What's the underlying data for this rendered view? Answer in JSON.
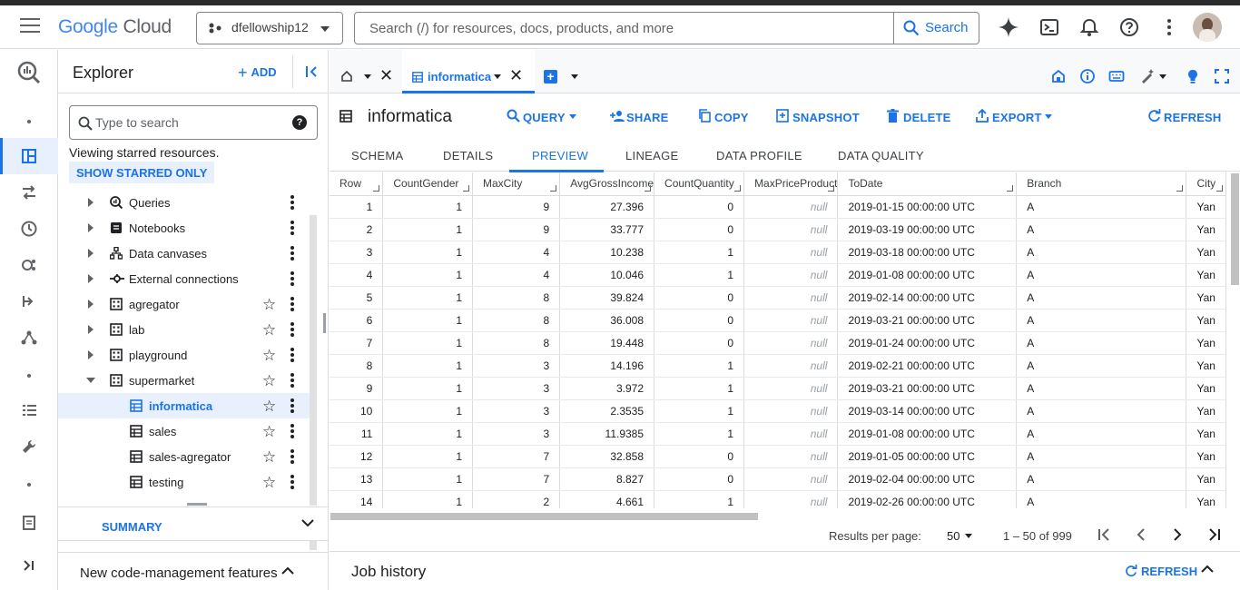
{
  "header": {
    "logo_google": "Google",
    "logo_cloud": "Cloud",
    "project": "dfellowship12",
    "search_placeholder": "Search (/) for resources, docs, products, and more",
    "search_button": "Search",
    "colors": {
      "accent": "#1a73e8",
      "text": "#202124"
    }
  },
  "explorer": {
    "title": "Explorer",
    "add_label": "ADD",
    "search_placeholder": "Type to search",
    "starred_note": "Viewing starred resources.",
    "show_starred": "SHOW STARRED ONLY",
    "tree": [
      {
        "label": "Queries",
        "icon": "queries-icon",
        "level": 0,
        "expanded": false,
        "starrable": false
      },
      {
        "label": "Notebooks",
        "icon": "notebook-icon",
        "level": 0,
        "expanded": false,
        "starrable": false
      },
      {
        "label": "Data canvases",
        "icon": "canvas-icon",
        "level": 0,
        "expanded": false,
        "starrable": false
      },
      {
        "label": "External connections",
        "icon": "connection-icon",
        "level": 0,
        "expanded": false,
        "starrable": false
      },
      {
        "label": "agregator",
        "icon": "dataset-icon",
        "level": 0,
        "expanded": false,
        "starrable": true
      },
      {
        "label": "lab",
        "icon": "dataset-icon",
        "level": 0,
        "expanded": false,
        "starrable": true
      },
      {
        "label": "playground",
        "icon": "dataset-icon",
        "level": 0,
        "expanded": false,
        "starrable": true
      },
      {
        "label": "supermarket",
        "icon": "dataset-icon",
        "level": 0,
        "expanded": true,
        "starrable": true
      },
      {
        "label": "informatica",
        "icon": "table-icon",
        "level": 1,
        "selected": true,
        "starrable": true
      },
      {
        "label": "sales",
        "icon": "table-icon",
        "level": 1,
        "starrable": true
      },
      {
        "label": "sales-agregator",
        "icon": "table-icon",
        "level": 1,
        "starrable": true
      },
      {
        "label": "testing",
        "icon": "table-icon",
        "level": 1,
        "starrable": true
      }
    ],
    "summary": "SUMMARY",
    "new_code": "New code-management features"
  },
  "tabs": {
    "active_label": "informatica"
  },
  "table": {
    "name": "informatica",
    "actions": {
      "query": "QUERY",
      "share": "SHARE",
      "copy": "COPY",
      "snapshot": "SNAPSHOT",
      "delete": "DELETE",
      "export": "EXPORT",
      "refresh": "REFRESH"
    },
    "subtabs": [
      "SCHEMA",
      "DETAILS",
      "PREVIEW",
      "LINEAGE",
      "DATA PROFILE",
      "DATA QUALITY"
    ],
    "active_subtab": "PREVIEW",
    "columns": [
      "Row",
      "CountGender",
      "MaxCity",
      "AvgGrossIncome",
      "CountQuantity",
      "MaxPriceProduct",
      "ToDate",
      "Branch",
      "City"
    ],
    "rows": [
      [
        "1",
        "1",
        "9",
        "27.396",
        "0",
        "null",
        "2019-01-15 00:00:00 UTC",
        "A",
        "Yan"
      ],
      [
        "2",
        "1",
        "9",
        "33.777",
        "0",
        "null",
        "2019-03-19 00:00:00 UTC",
        "A",
        "Yan"
      ],
      [
        "3",
        "1",
        "4",
        "10.238",
        "1",
        "null",
        "2019-03-18 00:00:00 UTC",
        "A",
        "Yan"
      ],
      [
        "4",
        "1",
        "4",
        "10.046",
        "1",
        "null",
        "2019-01-08 00:00:00 UTC",
        "A",
        "Yan"
      ],
      [
        "5",
        "1",
        "8",
        "39.824",
        "0",
        "null",
        "2019-02-14 00:00:00 UTC",
        "A",
        "Yan"
      ],
      [
        "6",
        "1",
        "8",
        "36.008",
        "0",
        "null",
        "2019-03-21 00:00:00 UTC",
        "A",
        "Yan"
      ],
      [
        "7",
        "1",
        "8",
        "19.448",
        "0",
        "null",
        "2019-01-24 00:00:00 UTC",
        "A",
        "Yan"
      ],
      [
        "8",
        "1",
        "3",
        "14.196",
        "1",
        "null",
        "2019-02-21 00:00:00 UTC",
        "A",
        "Yan"
      ],
      [
        "9",
        "1",
        "3",
        "3.972",
        "1",
        "null",
        "2019-03-21 00:00:00 UTC",
        "A",
        "Yan"
      ],
      [
        "10",
        "1",
        "3",
        "2.3535",
        "1",
        "null",
        "2019-03-14 00:00:00 UTC",
        "A",
        "Yan"
      ],
      [
        "11",
        "1",
        "3",
        "11.9385",
        "1",
        "null",
        "2019-01-08 00:00:00 UTC",
        "A",
        "Yan"
      ],
      [
        "12",
        "1",
        "7",
        "32.858",
        "0",
        "null",
        "2019-01-05 00:00:00 UTC",
        "A",
        "Yan"
      ],
      [
        "13",
        "1",
        "7",
        "8.827",
        "0",
        "null",
        "2019-02-04 00:00:00 UTC",
        "A",
        "Yan"
      ],
      [
        "14",
        "1",
        "2",
        "4.661",
        "1",
        "null",
        "2019-02-26 00:00:00 UTC",
        "A",
        "Yan"
      ]
    ]
  },
  "pager": {
    "results_per_page_label": "Results per page:",
    "results_per_page": "50",
    "range": "1 – 50 of 999"
  },
  "job_history": {
    "title": "Job history",
    "refresh": "REFRESH"
  }
}
